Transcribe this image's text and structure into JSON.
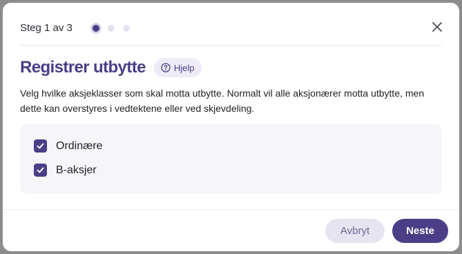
{
  "header": {
    "step_label": "Steg 1 av 3",
    "steps_total": 3,
    "current_step": 1
  },
  "title": "Registrer utbytte",
  "help_label": "Hjelp",
  "description": "Velg hvilke aksjeklasser som skal motta utbytte. Normalt vil alle aksjonærer motta utbytte, men dette kan overstyres i vedtektene eller ved skjevdeling.",
  "share_classes": [
    {
      "label": "Ordinære",
      "checked": true
    },
    {
      "label": "B-aksjer",
      "checked": true
    }
  ],
  "footer": {
    "cancel_label": "Avbryt",
    "next_label": "Neste"
  },
  "colors": {
    "accent": "#4b3d86",
    "accent_light": "#eeebf7",
    "panel_bg": "#f6f5fa"
  },
  "icons": {
    "close": "close-icon",
    "help": "question-circle-icon",
    "check": "check-icon"
  }
}
